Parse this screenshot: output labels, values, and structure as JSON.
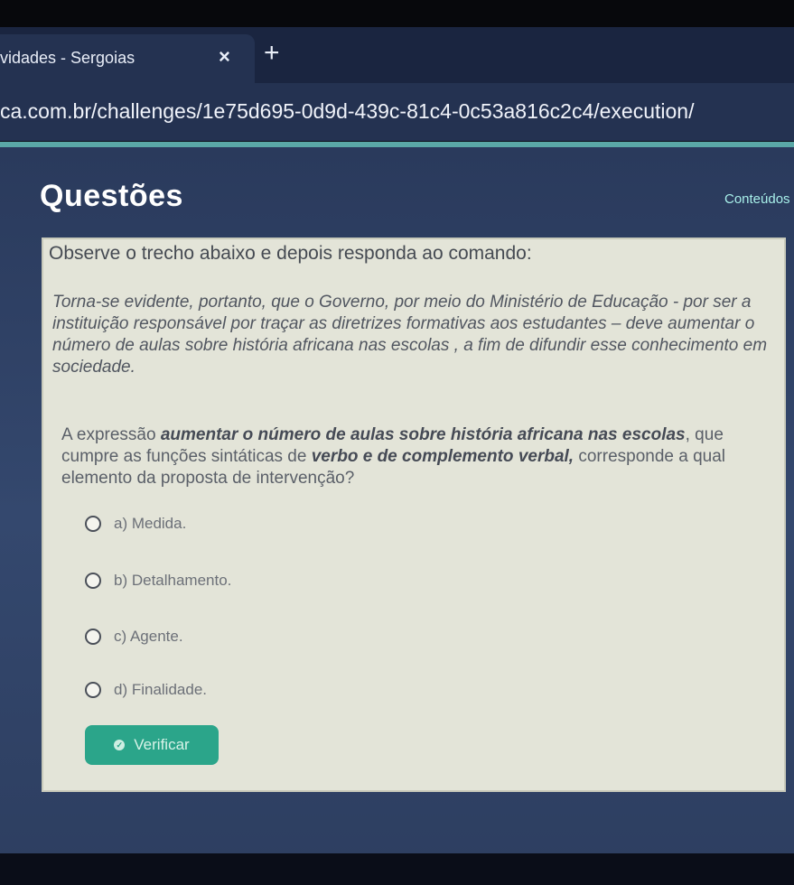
{
  "browser": {
    "tab_title": "vidades - Sergoias",
    "tab_close": "×",
    "new_tab": "+",
    "url": "ca.com.br/challenges/1e75d695-0d9d-439c-81c4-0c53a816c2c4/execution/"
  },
  "header": {
    "title": "Questões",
    "link": "Conteúdos"
  },
  "question": {
    "instruction": "Observe o trecho abaixo e depois responda ao comando:",
    "excerpt": "Torna-se evidente, portanto, que o Governo, por meio do Ministério de Educação - por ser a instituição responsável por traçar as diretrizes formativas aos estudantes – deve aumentar o número de aulas sobre história africana nas escolas , a fim de difundir esse conhecimento em sociedade.",
    "prompt": {
      "p1": "A expressão ",
      "b1": "aumentar o número de aulas sobre história africana nas escolas",
      "p2": ", que cumpre as funções sintáticas de ",
      "b2": "verbo e de complemento verbal,",
      "p3": " corresponde a qual elemento da proposta de intervenção?"
    },
    "options": [
      {
        "label": "a) Medida."
      },
      {
        "label": "b) Detalhamento."
      },
      {
        "label": "c) Agente."
      },
      {
        "label": "d) Finalidade."
      }
    ],
    "verify_label": "Verificar"
  },
  "colors": {
    "accent": "#2ba58a",
    "link": "#a8f0ea"
  }
}
